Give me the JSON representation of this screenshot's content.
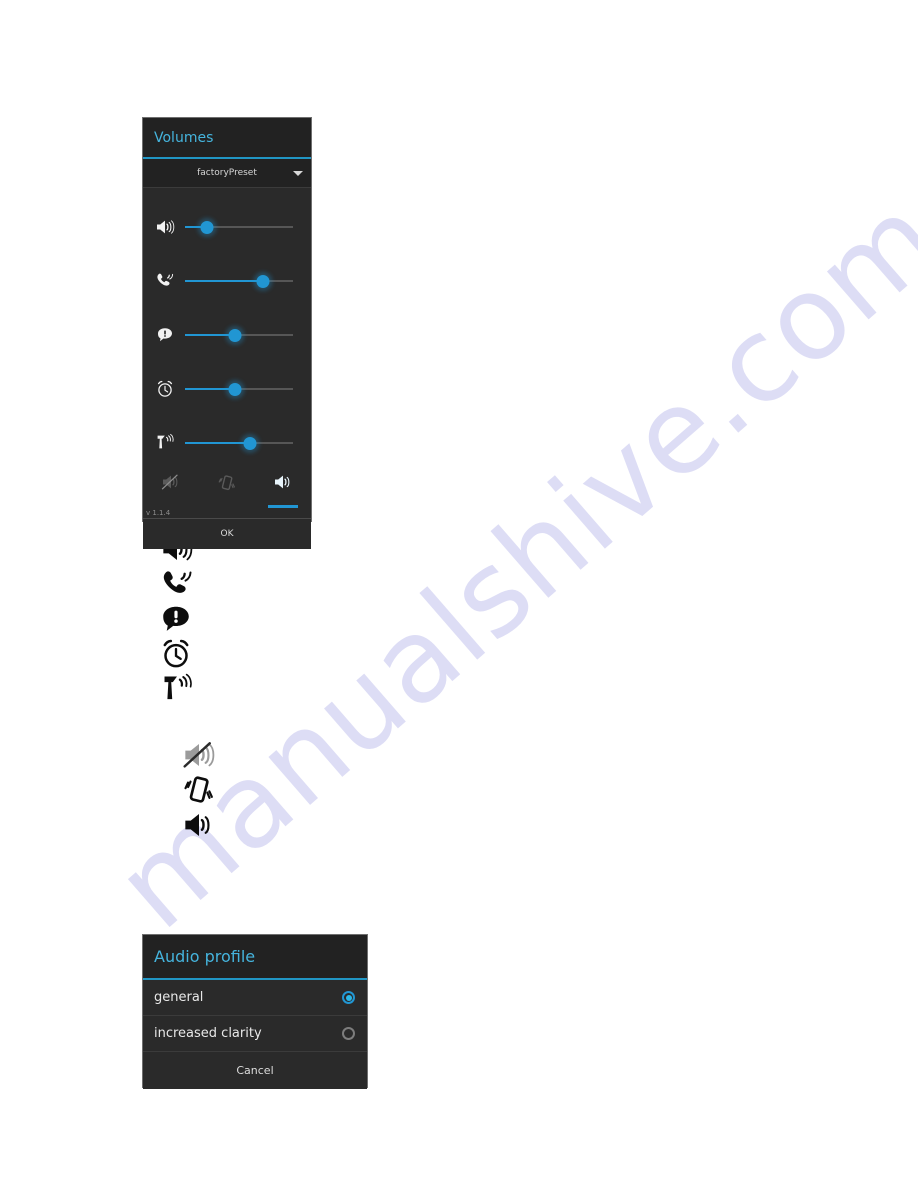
{
  "watermark": {
    "text": "manualshive.com",
    "color": "#c9c9ef"
  },
  "theme": {
    "accent": "#2196d3",
    "title_color": "#45b4dd",
    "dialog_bg": "#2a2a2a",
    "header_bg": "#222222"
  },
  "volumes_dialog": {
    "title": "Volumes",
    "preset": {
      "label": "factoryPreset",
      "caret_icon": "chevron-down-icon"
    },
    "sliders": [
      {
        "icon": "speaker-volume-icon",
        "name": "media-volume-slider",
        "value": 20
      },
      {
        "icon": "phone-ringtone-icon",
        "name": "ringtone-volume-slider",
        "value": 72
      },
      {
        "icon": "notification-alert-icon",
        "name": "notification-volume-slider",
        "value": 46
      },
      {
        "icon": "alarm-clock-icon",
        "name": "alarm-volume-slider",
        "value": 46
      },
      {
        "icon": "handset-earpiece-icon",
        "name": "earpiece-volume-slider",
        "value": 60
      }
    ],
    "tabs": [
      {
        "icon": "mute-speaker-icon",
        "name": "tab-silent",
        "active": false
      },
      {
        "icon": "vibrate-phone-icon",
        "name": "tab-vibrate",
        "active": false
      },
      {
        "icon": "speaker-volume-icon",
        "name": "tab-sound",
        "active": true
      }
    ],
    "version": "v 1.1.4",
    "ok_label": "OK"
  },
  "legend_main": [
    {
      "icon": "speaker-volume-icon",
      "name": "legend-media-volume"
    },
    {
      "icon": "phone-ringtone-icon",
      "name": "legend-ringtone-volume"
    },
    {
      "icon": "notification-alert-icon",
      "name": "legend-notification-volume"
    },
    {
      "icon": "alarm-clock-icon",
      "name": "legend-alarm-volume"
    },
    {
      "icon": "handset-earpiece-icon",
      "name": "legend-earpiece-volume"
    }
  ],
  "legend_modes": [
    {
      "icon": "mute-speaker-icon",
      "name": "legend-silent-mode"
    },
    {
      "icon": "vibrate-phone-icon",
      "name": "legend-vibrate-mode"
    },
    {
      "icon": "speaker-volume-icon",
      "name": "legend-sound-mode"
    }
  ],
  "audio_profile_dialog": {
    "title": "Audio profile",
    "options": [
      {
        "label": "general",
        "selected": true
      },
      {
        "label": "increased clarity",
        "selected": false
      }
    ],
    "cancel_label": "Cancel"
  }
}
